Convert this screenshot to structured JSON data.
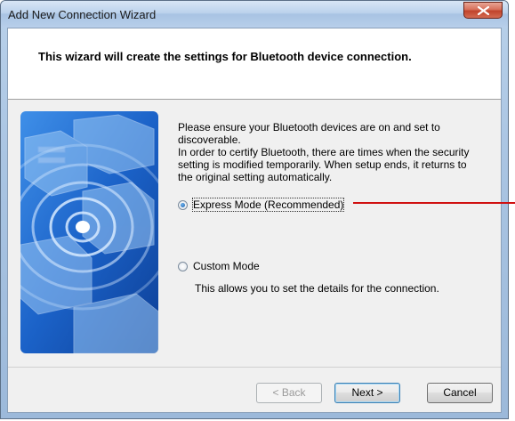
{
  "window": {
    "title": "Add New Connection Wizard"
  },
  "header": {
    "text": "This wizard will create the settings for Bluetooth device connection."
  },
  "content": {
    "line1": "Please ensure your Bluetooth devices are on and set to",
    "line2": "discoverable.",
    "line3": "In order to certify Bluetooth, there are times when the security",
    "line4": "setting is modified temporarily. When setup ends, it returns to",
    "line5": "the original setting automatically."
  },
  "options": {
    "express": {
      "label": "Express Mode (Recommended)",
      "selected": true
    },
    "custom": {
      "label": "Custom Mode",
      "selected": false,
      "description": "This allows you to set the details for the connection."
    }
  },
  "buttons": {
    "back": "< Back",
    "next": "Next >",
    "cancel": "Cancel"
  },
  "colors": {
    "annotation_line": "#d01010",
    "title_bar": "#bcd2ec",
    "illustration": "#1e63c7"
  },
  "icons": {
    "close": "close-icon",
    "illustration": "bluetooth-devices-illustration"
  }
}
